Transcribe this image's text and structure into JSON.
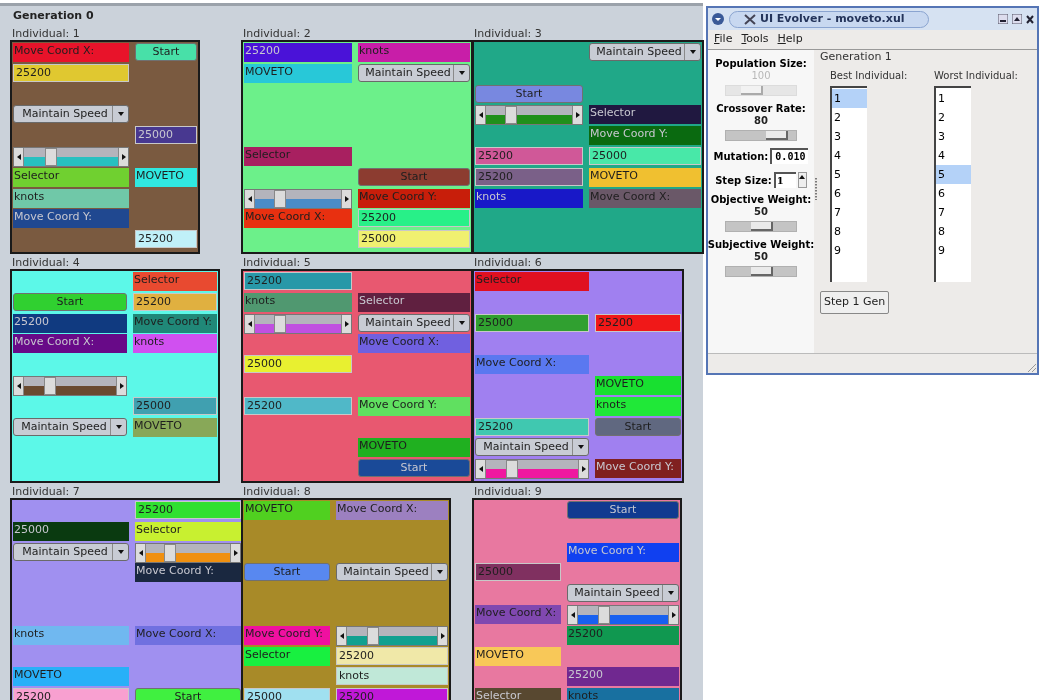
{
  "generation_title": "Generation 0",
  "individuals": [
    {
      "label": "Individual: 1",
      "color": "#7a5a40",
      "widgets": [
        {
          "kind": "label",
          "text": "Move Coord X:",
          "color": "#e8132a"
        },
        {
          "kind": "button",
          "text": "Start",
          "color": "#48e0a8"
        },
        {
          "kind": "textbox",
          "value": "25200",
          "color": "#e0c830"
        },
        {
          "kind": "menulist",
          "text": "Maintain Speed"
        },
        {
          "kind": "textbox",
          "value": "25000",
          "color": "#483890"
        },
        {
          "kind": "slider",
          "color": "#28c0c0"
        },
        {
          "kind": "label",
          "text": "Selector",
          "color": "#70d030"
        },
        {
          "kind": "label",
          "text": "MOVETO",
          "color": "#30e8e0"
        },
        {
          "kind": "label",
          "text": "knots",
          "color": "#70c8a8"
        },
        {
          "kind": "label",
          "text": "Move Coord Y:",
          "color": "#204890"
        },
        {
          "kind": "textbox",
          "value": "25200",
          "color": "#c0f0f8"
        }
      ]
    },
    {
      "label": "Individual: 2",
      "color": "#6cf08a",
      "widgets": [
        {
          "kind": "label",
          "text": "25200",
          "color": "#4a12d8"
        },
        {
          "kind": "label",
          "text": "knots",
          "color": "#c81ea8"
        },
        {
          "kind": "label",
          "text": "MOVETO",
          "color": "#28c8d8"
        },
        {
          "kind": "menulist",
          "text": "Maintain Speed"
        },
        {
          "kind": "label",
          "text": "Selector",
          "color": "#a82060"
        },
        {
          "kind": "button",
          "text": "Start",
          "color": "#8c3c30"
        },
        {
          "kind": "slider",
          "color": "#4a8cc8"
        },
        {
          "kind": "label",
          "text": "Move Coord Y:",
          "color": "#c81e0a"
        },
        {
          "kind": "label",
          "text": "Move Coord X:",
          "color": "#e83010"
        },
        {
          "kind": "textbox",
          "value": "25200",
          "color": "#28f088"
        },
        {
          "kind": "textbox",
          "value": "25000",
          "color": "#f0f070"
        }
      ]
    },
    {
      "label": "Individual: 3",
      "color": "#20a888",
      "widgets": [
        {
          "kind": "menulist",
          "text": "Maintain Speed"
        },
        {
          "kind": "button",
          "text": "Start",
          "color": "#7888e0"
        },
        {
          "kind": "slider",
          "color": "#20901a"
        },
        {
          "kind": "label",
          "text": "Selector",
          "color": "#201840"
        },
        {
          "kind": "label",
          "text": "Move Coord Y:",
          "color": "#0a6a10"
        },
        {
          "kind": "textbox",
          "value": "25200",
          "color": "#d05898"
        },
        {
          "kind": "textbox",
          "value": "25000",
          "color": "#48e8a8"
        },
        {
          "kind": "textbox",
          "value": "25200",
          "color": "#7a6088"
        },
        {
          "kind": "label",
          "text": "MOVETO",
          "color": "#f0c030"
        },
        {
          "kind": "label",
          "text": "knots",
          "color": "#1818c8"
        },
        {
          "kind": "label",
          "text": "Move Coord X:",
          "color": "#6a5868"
        }
      ]
    },
    {
      "label": "Individual: 4",
      "color": "#5cf8e8",
      "widgets": [
        {
          "kind": "label",
          "text": "Selector",
          "color": "#e84a30"
        },
        {
          "kind": "button",
          "text": "Start",
          "color": "#30d030"
        },
        {
          "kind": "textbox",
          "value": "25200",
          "color": "#e0b040"
        },
        {
          "kind": "label",
          "text": "25200",
          "color": "#103a80"
        },
        {
          "kind": "label",
          "text": "Move Coord Y:",
          "color": "#208878"
        },
        {
          "kind": "label",
          "text": "Move Coord X:",
          "color": "#680a88"
        },
        {
          "kind": "label",
          "text": "knots",
          "color": "#d050f0"
        },
        {
          "kind": "slider",
          "color": "#6a4a30"
        },
        {
          "kind": "textbox",
          "value": "25000",
          "color": "#40a0b0"
        },
        {
          "kind": "menulist",
          "text": "Maintain Speed"
        },
        {
          "kind": "label",
          "text": "MOVETO",
          "color": "#88a858"
        }
      ]
    },
    {
      "label": "Individual: 5",
      "color": "#e85870",
      "widgets": [
        {
          "kind": "textbox",
          "value": "25200",
          "color": "#2898a8"
        },
        {
          "kind": "label",
          "text": "knots",
          "color": "#509870"
        },
        {
          "kind": "label",
          "text": "Selector",
          "color": "#602040"
        },
        {
          "kind": "slider",
          "color": "#c050e0"
        },
        {
          "kind": "menulist",
          "text": "Maintain Speed"
        },
        {
          "kind": "label",
          "text": "Move Coord X:",
          "color": "#7060e0"
        },
        {
          "kind": "textbox",
          "value": "25000",
          "color": "#e8f030"
        },
        {
          "kind": "textbox",
          "value": "25200",
          "color": "#50b8c8"
        },
        {
          "kind": "label",
          "text": "Move Coord Y:",
          "color": "#60e060"
        },
        {
          "kind": "label",
          "text": "MOVETO",
          "color": "#20b020"
        },
        {
          "kind": "button",
          "text": "Start",
          "color": "#1a4a98"
        }
      ]
    },
    {
      "label": "Individual: 6",
      "color": "#a080f0",
      "widgets": [
        {
          "kind": "label",
          "text": "Selector",
          "color": "#e01020"
        },
        {
          "kind": "textbox",
          "value": "25000",
          "color": "#30a030"
        },
        {
          "kind": "textbox",
          "value": "25200",
          "color": "#f01818"
        },
        {
          "kind": "label",
          "text": "Move Coord X:",
          "color": "#5a78f0"
        },
        {
          "kind": "label",
          "text": "MOVETO",
          "color": "#18e030"
        },
        {
          "kind": "label",
          "text": "knots",
          "color": "#20e838"
        },
        {
          "kind": "textbox",
          "value": "25200",
          "color": "#40c8b0"
        },
        {
          "kind": "button",
          "text": "Start",
          "color": "#606880"
        },
        {
          "kind": "menulist",
          "text": "Maintain Speed"
        },
        {
          "kind": "slider",
          "color": "#f018a0"
        },
        {
          "kind": "label",
          "text": "Move Coord Y:",
          "color": "#802020"
        }
      ]
    },
    {
      "label": "Individual: 7",
      "color": "#a090f0",
      "widgets": [
        {
          "kind": "textbox",
          "value": "25200",
          "color": "#30e030"
        },
        {
          "kind": "label",
          "text": "25000",
          "color": "#0a3a10"
        },
        {
          "kind": "label",
          "text": "Selector",
          "color": "#c8f030"
        },
        {
          "kind": "menulist",
          "text": "Maintain Speed"
        },
        {
          "kind": "slider",
          "color": "#f09010"
        },
        {
          "kind": "label",
          "text": "Move Coord Y:",
          "color": "#1a2840"
        },
        {
          "kind": "label",
          "text": "knots",
          "color": "#70b8f0"
        },
        {
          "kind": "label",
          "text": "Move Coord X:",
          "color": "#7070e0"
        },
        {
          "kind": "label",
          "text": "MOVETO",
          "color": "#28b0f8"
        },
        {
          "kind": "textbox",
          "value": "25200",
          "color": "#f8a0d0"
        },
        {
          "kind": "button",
          "text": "Start",
          "color": "#40f040"
        }
      ]
    },
    {
      "label": "Individual: 8",
      "color": "#a88a28",
      "widgets": [
        {
          "kind": "label",
          "text": "MOVETO",
          "color": "#50d020"
        },
        {
          "kind": "label",
          "text": "Move Coord X:",
          "color": "#9c80c0"
        },
        {
          "kind": "button",
          "text": "Start",
          "color": "#5888f0"
        },
        {
          "kind": "menulist",
          "text": "Maintain Speed"
        },
        {
          "kind": "label",
          "text": "Move Coord Y:",
          "color": "#f010a0"
        },
        {
          "kind": "slider",
          "color": "#10a090"
        },
        {
          "kind": "label",
          "text": "Selector",
          "color": "#18f040"
        },
        {
          "kind": "textbox",
          "value": "25200",
          "color": "#f0e8a8"
        },
        {
          "kind": "textbox",
          "value": "knots",
          "color": "#c0e8d8"
        },
        {
          "kind": "textbox",
          "value": "25000",
          "color": "#a0e0f0"
        },
        {
          "kind": "textbox",
          "value": "25200",
          "color": "#c018d8"
        }
      ]
    },
    {
      "label": "Individual: 9",
      "color": "#e878a0",
      "widgets": [
        {
          "kind": "button",
          "text": "Start",
          "color": "#103a90"
        },
        {
          "kind": "label",
          "text": "Move Coord Y:",
          "color": "#1040f0"
        },
        {
          "kind": "textbox",
          "value": "25000",
          "color": "#803060"
        },
        {
          "kind": "menulist",
          "text": "Maintain Speed"
        },
        {
          "kind": "label",
          "text": "Move Coord X:",
          "color": "#8048b0"
        },
        {
          "kind": "slider",
          "color": "#1860f0"
        },
        {
          "kind": "label",
          "text": "25200",
          "color": "#109850"
        },
        {
          "kind": "label",
          "text": "MOVETO",
          "color": "#f8c858"
        },
        {
          "kind": "label",
          "text": "25200",
          "color": "#702890"
        },
        {
          "kind": "label",
          "text": "Selector",
          "color": "#584830"
        },
        {
          "kind": "label",
          "text": "knots",
          "color": "#1870a0"
        }
      ]
    }
  ],
  "window": {
    "title": "UI Evolver - moveto.xul",
    "menu": [
      "File",
      "Tools",
      "Help"
    ],
    "settings": [
      {
        "kind": "slider",
        "label": "Population Size:",
        "value": "100",
        "disabled": true,
        "level": 0.3
      },
      {
        "kind": "slider",
        "label": "Crossover Rate:",
        "value": "80",
        "disabled": false,
        "level": 0.8
      },
      {
        "kind": "field",
        "label": "Mutation:",
        "value": "0.010"
      },
      {
        "kind": "spin",
        "label": "Step Size:",
        "value": "1"
      },
      {
        "kind": "slider",
        "label": "Objective Weight:",
        "value": "50",
        "disabled": false,
        "level": 0.5
      },
      {
        "kind": "slider",
        "label": "Subjective Weight:",
        "value": "50",
        "disabled": false,
        "level": 0.5
      }
    ],
    "generation": "Generation 1",
    "best": {
      "heading": "Best Individual:",
      "items": [
        {
          "label": "1",
          "selected": true
        },
        {
          "label": "2",
          "selected": false
        },
        {
          "label": "3",
          "selected": false
        },
        {
          "label": "4",
          "selected": false
        },
        {
          "label": "5",
          "selected": false
        },
        {
          "label": "6",
          "selected": false
        },
        {
          "label": "7",
          "selected": false
        },
        {
          "label": "8",
          "selected": false
        },
        {
          "label": "9",
          "selected": false
        }
      ]
    },
    "worst": {
      "heading": "Worst Individual:",
      "items": [
        {
          "label": "1",
          "selected": false
        },
        {
          "label": "2",
          "selected": false
        },
        {
          "label": "3",
          "selected": false
        },
        {
          "label": "4",
          "selected": false
        },
        {
          "label": "5",
          "selected": true
        },
        {
          "label": "6",
          "selected": false
        },
        {
          "label": "7",
          "selected": false
        },
        {
          "label": "8",
          "selected": false
        },
        {
          "label": "9",
          "selected": false
        }
      ]
    },
    "step_button": "Step 1 Gen"
  }
}
